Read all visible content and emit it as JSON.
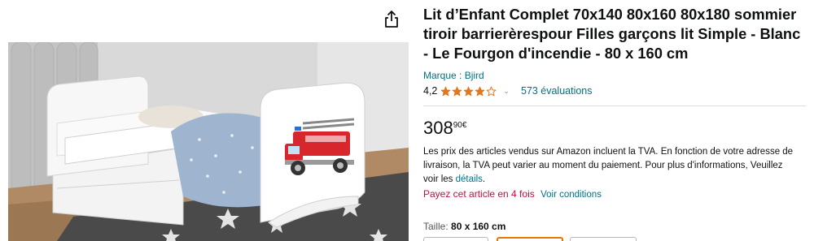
{
  "product": {
    "title": "Lit d’Enfant Complet 70x140 80x160 80x180 sommier tiroir barrierèrespour Filles garçons lit Simple - Blanc - Le Fourgon d'incendie - 80 x 160 cm",
    "brand_link": "Marque : Bjird",
    "rating_value": "4,2",
    "rating_stars": 4.2,
    "ratings_count": "573 évaluations",
    "price_whole": "308",
    "price_fraction": "90",
    "price_currency": "€",
    "vat_text": "Les prix des articles vendus sur Amazon incluent la TVA. En fonction de votre adresse de livraison, la TVA peut varier au moment du paiement. Pour plus d'informations, Veuillez voir les",
    "vat_link": "détails",
    "vat_end": ".",
    "pay_text": "Payez cet article en 4 fois",
    "conditions_link": "Voir conditions",
    "size_label": "Taille: ",
    "size_value": "80 x 160 cm"
  },
  "icons": {
    "share": "share-icon",
    "star": "star-icon",
    "chevron": "chevron-down-icon"
  },
  "colors": {
    "link": "#007185",
    "star": "#de7921",
    "pay": "#cc0c39",
    "swatch_selected": "#e77600"
  }
}
